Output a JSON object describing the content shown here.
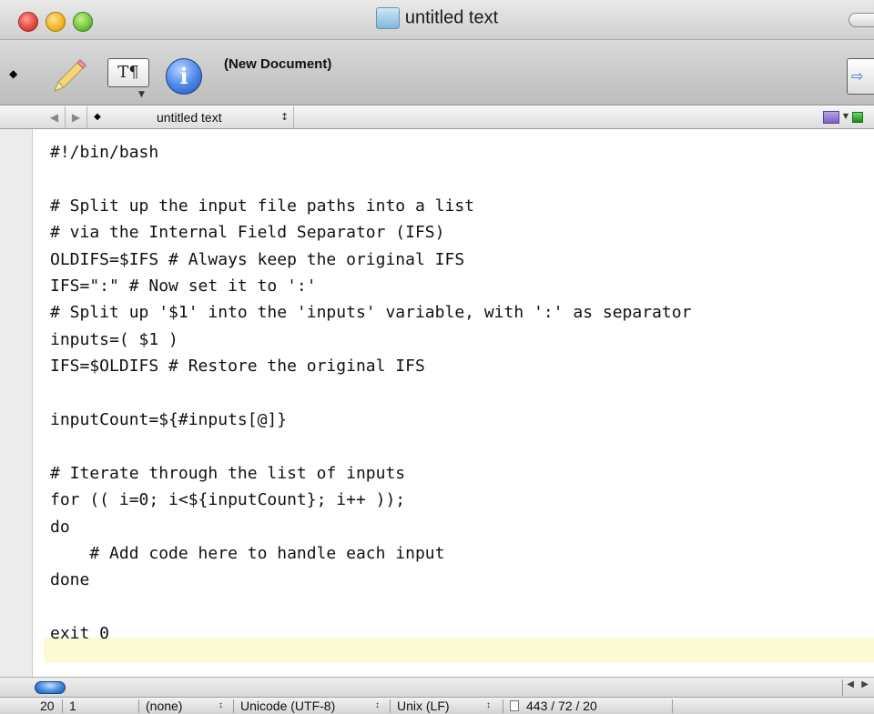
{
  "window": {
    "title": "untitled text"
  },
  "toolbar": {
    "document_label": "(New Document)",
    "text_button_glyph": "T¶",
    "info_glyph": "i",
    "right_button_glyph": "⇨"
  },
  "navbar": {
    "back_glyph": "◀",
    "forward_glyph": "▶",
    "diamond_glyph": "◆",
    "document_name": "untitled text",
    "updown_glyph": "↕"
  },
  "editor": {
    "current_line_color": "#fdfbd5",
    "lines": [
      "#!/bin/bash",
      "",
      "# Split up the input file paths into a list",
      "# via the Internal Field Separator (IFS)",
      "OLDIFS=$IFS # Always keep the original IFS",
      "IFS=\":\" # Now set it to ':'",
      "# Split up '$1' into the 'inputs' variable, with ':' as separator",
      "inputs=( $1 )",
      "IFS=$OLDIFS # Restore the original IFS",
      "",
      "inputCount=${#inputs[@]}",
      "",
      "# Iterate through the list of inputs",
      "for (( i=0; i<${inputCount}; i++ ));",
      "do",
      "    # Add code here to handle each input",
      "done",
      "",
      "exit 0"
    ]
  },
  "statusbar": {
    "line": "20",
    "column": "1",
    "syntax": "(none)",
    "encoding": "Unicode (UTF-8)",
    "line_endings": "Unix (LF)",
    "stats": "443 / 72 / 20",
    "updown_glyph": "↕"
  }
}
